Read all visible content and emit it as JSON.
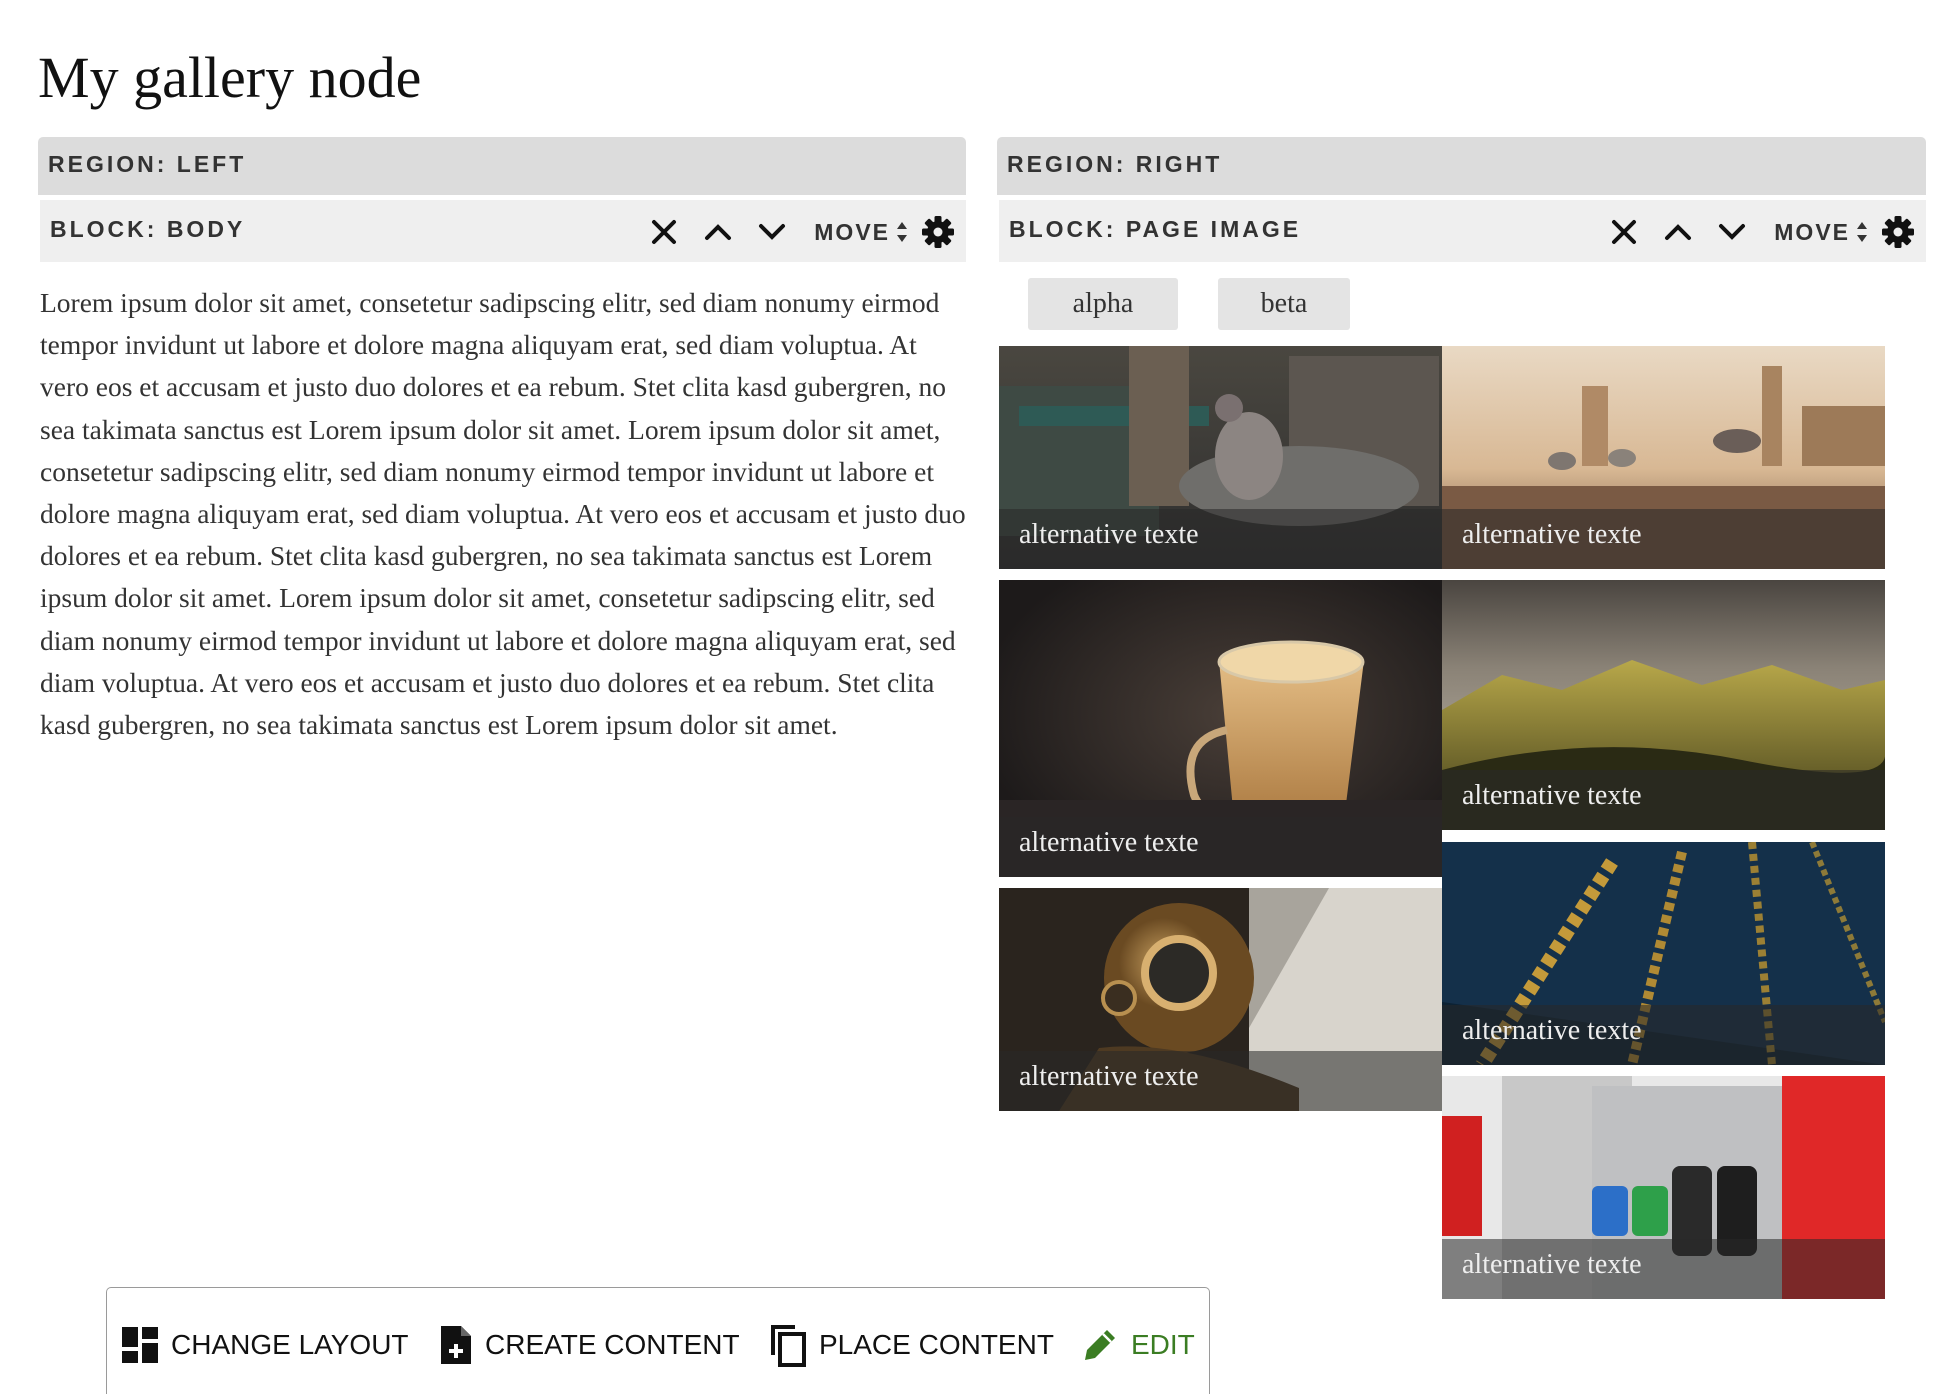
{
  "page": {
    "title": "My gallery node"
  },
  "regions": {
    "left": {
      "label": "REGION: LEFT",
      "block": {
        "label": "BLOCK: BODY",
        "move_label": "MOVE"
      },
      "body_text": "Lorem ipsum dolor sit amet, consetetur sadipscing elitr, sed diam nonumy eirmod tempor invidunt ut labore et dolore magna aliquyam erat, sed diam voluptua. At vero eos et accusam et justo duo dolores et ea rebum. Stet clita kasd gubergren, no sea takimata sanctus est Lorem ipsum dolor sit amet. Lorem ipsum dolor sit amet, consetetur sadipscing elitr, sed diam nonumy eirmod tempor invidunt ut labore et dolore magna aliquyam erat, sed diam voluptua. At vero eos et accusam et justo duo dolores et ea rebum. Stet clita kasd gubergren, no sea takimata sanctus est Lorem ipsum dolor sit amet. Lorem ipsum dolor sit amet, consetetur sadipscing elitr, sed diam nonumy eirmod tempor invidunt ut labore et dolore magna aliquyam erat, sed diam voluptua. At vero eos et accusam et justo duo dolores et ea rebum. Stet clita kasd gubergren, no sea takimata sanctus est Lorem ipsum dolor sit amet."
    },
    "right": {
      "label": "REGION: RIGHT",
      "block": {
        "label": "BLOCK: PAGE IMAGE",
        "move_label": "MOVE"
      },
      "filters": [
        "alpha",
        "beta"
      ],
      "gallery": [
        {
          "caption": "alternative texte",
          "subject": "pigeon on a street"
        },
        {
          "caption": "alternative texte",
          "subject": "pigeons over London skyline"
        },
        {
          "caption": "alternative texte",
          "subject": "glass coffee cup"
        },
        {
          "caption": "alternative texte",
          "subject": "mountain landscape"
        },
        {
          "caption": "alternative texte",
          "subject": "vintage diving helmet"
        },
        {
          "caption": "alternative texte",
          "subject": "gold chains"
        },
        {
          "caption": "alternative texte",
          "subject": "fuel pump nozzles"
        }
      ]
    }
  },
  "toolbar": {
    "change_layout": "CHANGE LAYOUT",
    "create_content": "CREATE CONTENT",
    "place_content": "PLACE CONTENT",
    "edit": "EDIT"
  },
  "colors": {
    "accent_green": "#3b7d23",
    "region_bg": "#dcdcdc",
    "block_bg": "#efefef"
  }
}
